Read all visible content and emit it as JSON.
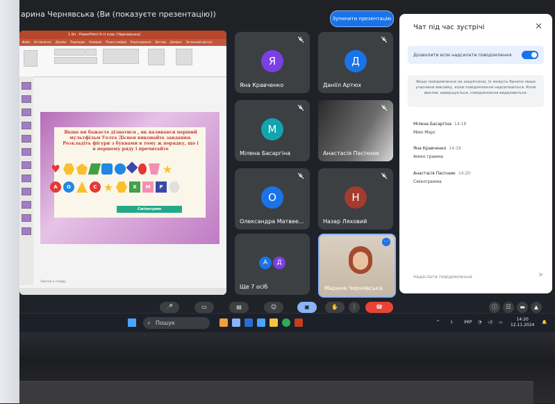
{
  "window": {
    "title": "арина Чернявська (Ви (показуєте презентацію))",
    "stop_presenting": "Зупинити презентацію"
  },
  "presentation": {
    "app_title": "1 бп · PowerPoint 9-ті клас (Чернявська)",
    "tabs": [
      "Файл",
      "Вставлення",
      "Дизайн",
      "Переходи",
      "Анімація",
      "Показ слайдів",
      "Рецензування",
      "Вигляд",
      "Довідка",
      "Загальний доступ"
    ],
    "slide_text": "Якщо ви бажаєте дізнатися , як називався перший мультфільм Уолта Діснея виконайте завдання. Розкладіть фігури з буквами в тому ж порядку, що і в першому ряду і прочитайте",
    "row1_shapes": [
      "heart",
      "hexagon",
      "pentagon",
      "parallelogram",
      "rectangle",
      "circle",
      "diamond",
      "oval",
      "trapezoid",
      "star"
    ],
    "row2_letters": [
      "А",
      "О",
      "",
      "С",
      "",
      "",
      "Х",
      "М",
      "Р",
      ""
    ],
    "answer_button": "Смілогрмм",
    "notes_placeholder": "Замітки к слайду"
  },
  "participants": [
    {
      "name": "Яна Кравченко",
      "initial": "Я",
      "color": "#7b3fe4"
    },
    {
      "name": "Даніїл Артюх",
      "initial": "Д",
      "color": "#1a73e8"
    },
    {
      "name": "Мілена Басаргіна",
      "initial": "М",
      "color": "#12a4af"
    },
    {
      "name": "Анастасія Пасічник",
      "initial": "",
      "color": "#333"
    },
    {
      "name": "Олександра Матвее...",
      "initial": "О",
      "color": "#1a73e8"
    },
    {
      "name": "Назар Ляховий",
      "initial": "Н",
      "color": "#a33b2f"
    },
    {
      "name": "Ще 7 осіб",
      "initial": "АД",
      "color": "#1a73e8"
    },
    {
      "name": "Марина Чернявська",
      "initial": "",
      "color": "#555"
    }
  ],
  "chat": {
    "title": "Чат під час зустрічі",
    "allow_label": "Дозволити всім надсилати повідомлення",
    "info": "Якщо повідомлення не закріплено, їх можуть бачити лише учасники виклику, коли повідомлення надсилаються. Коли виклик завершується, повідомлення видаляються.",
    "messages": [
      {
        "author": "Мілена Басаргіна",
        "time": "14:18",
        "text": "Микі Маус"
      },
      {
        "author": "Яна Кравченко",
        "time": "14:19",
        "text": "Аміко грамма"
      },
      {
        "author": "Анастасія Пасічник",
        "time": "14:20",
        "text": "Смікогрємма"
      }
    ],
    "send_placeholder": "Надіслати повідомлення"
  },
  "taskbar": {
    "search": "Пошук",
    "lang": "УКР",
    "time": "14:20",
    "date": "12.11.2024"
  },
  "colors": {
    "accent": "#1a73e8",
    "tile": "#3c4043",
    "end_call": "#ea4335"
  }
}
